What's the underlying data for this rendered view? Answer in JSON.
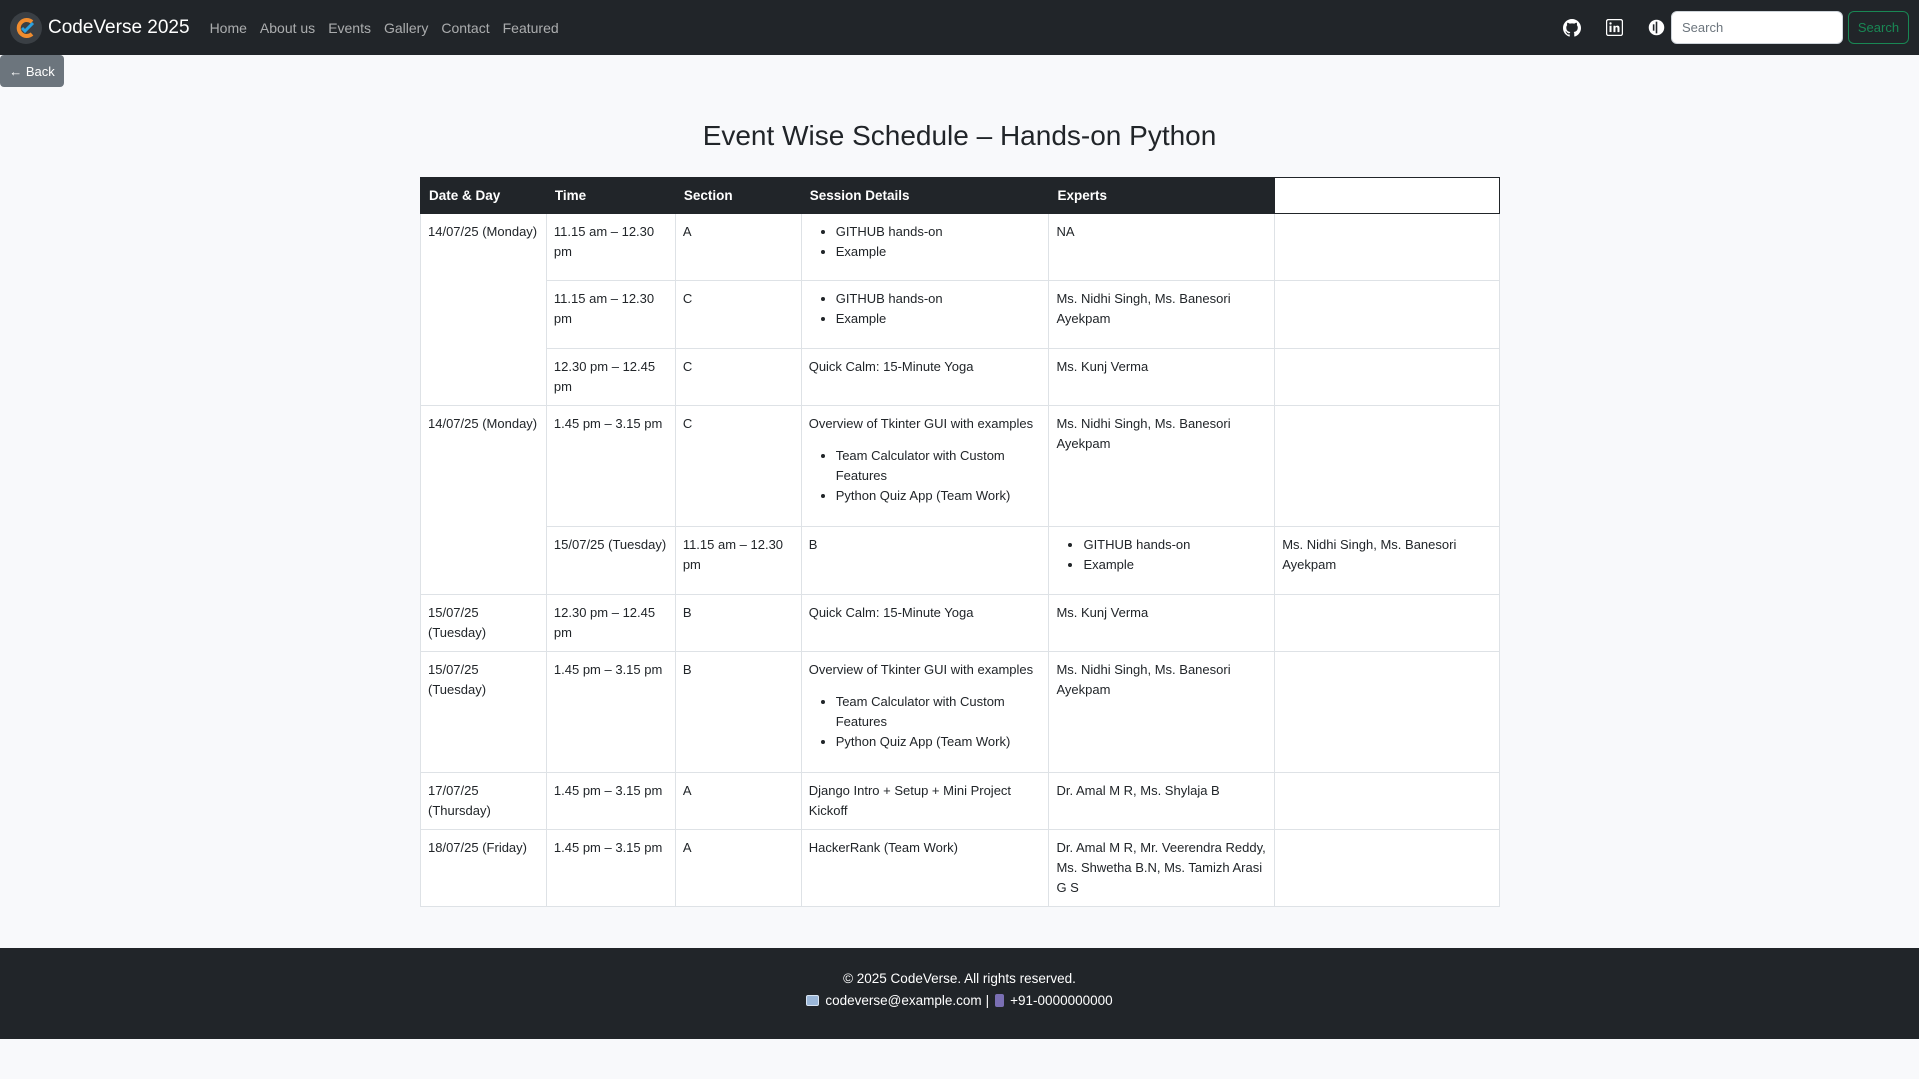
{
  "navbar": {
    "brand": "CodeVerse 2025",
    "links": [
      "Home",
      "About us",
      "Events",
      "Gallery",
      "Contact",
      "Featured"
    ],
    "search_placeholder": "Search",
    "search_button": "Search"
  },
  "back_label": "← Back",
  "title": "Event Wise Schedule – Hands-on Python",
  "table": {
    "headers": [
      "Date & Day",
      "Time",
      "Section",
      "Session Details",
      "Experts"
    ],
    "rows": [
      {
        "date": "14/07/25 (Monday)",
        "time": "11.15 am – 12.30 pm",
        "section": "A",
        "details": [
          "GITHUB hands-on",
          "Example"
        ],
        "experts": "NA"
      },
      {
        "time": "11.15 am – 12.30 pm",
        "section": "C",
        "details": [
          "GITHUB hands-on",
          "Example"
        ],
        "experts": "Ms. Nidhi Singh, Ms. Banesori Ayekpam"
      },
      {
        "time": "12.30 pm – 12.45 pm",
        "section": "C",
        "details_text": "Quick Calm: 15-Minute Yoga",
        "experts": "Ms. Kunj Verma"
      },
      {
        "date": "14/07/25 (Monday)",
        "time": "1.45 pm – 3.15 pm",
        "section": "C",
        "details_text": "Overview of Tkinter GUI with examples",
        "details": [
          "Team Calculator with Custom Features",
          "Python Quiz App (Team Work)"
        ],
        "experts": "Ms. Nidhi Singh, Ms. Banesori Ayekpam"
      },
      {
        "shifted": true,
        "time": "15/07/25 (Tuesday)",
        "section": "11.15 am – 12.30 pm",
        "details_text": "B",
        "experts_list": [
          "GITHUB hands-on",
          "Example"
        ],
        "extra": "Ms. Nidhi Singh, Ms. Banesori Ayekpam"
      },
      {
        "date": "15/07/25 (Tuesday)",
        "time": "12.30 pm – 12.45 pm",
        "section": "B",
        "details_text": "Quick Calm: 15-Minute Yoga",
        "experts": "Ms. Kunj Verma"
      },
      {
        "date": "15/07/25 (Tuesday)",
        "time": "1.45 pm – 3.15 pm",
        "section": "B",
        "details_text": "Overview of Tkinter GUI with examples",
        "details": [
          "Team Calculator with Custom Features",
          "Python Quiz App (Team Work)"
        ],
        "experts": "Ms. Nidhi Singh, Ms. Banesori Ayekpam"
      },
      {
        "date": "17/07/25 (Thursday)",
        "time": "1.45 pm – 3.15 pm",
        "section": "A",
        "details_text": "Django Intro + Setup + Mini Project Kickoff",
        "experts": "Dr. Amal M R, Ms. Shylaja B"
      },
      {
        "date": "18/07/25 (Friday)",
        "time": "1.45 pm – 3.15 pm",
        "section": "A",
        "details_text": "HackerRank (Team Work)",
        "experts": "Dr. Amal M R, Mr. Veerendra Reddy, Ms. Shwetha B.N, Ms. Tamizh Arasi G S"
      }
    ]
  },
  "footer": {
    "copyright": "© 2025 CodeVerse. All rights reserved.",
    "email": "codeverse@example.com",
    "separator": "|",
    "phone": "+91-0000000000"
  }
}
